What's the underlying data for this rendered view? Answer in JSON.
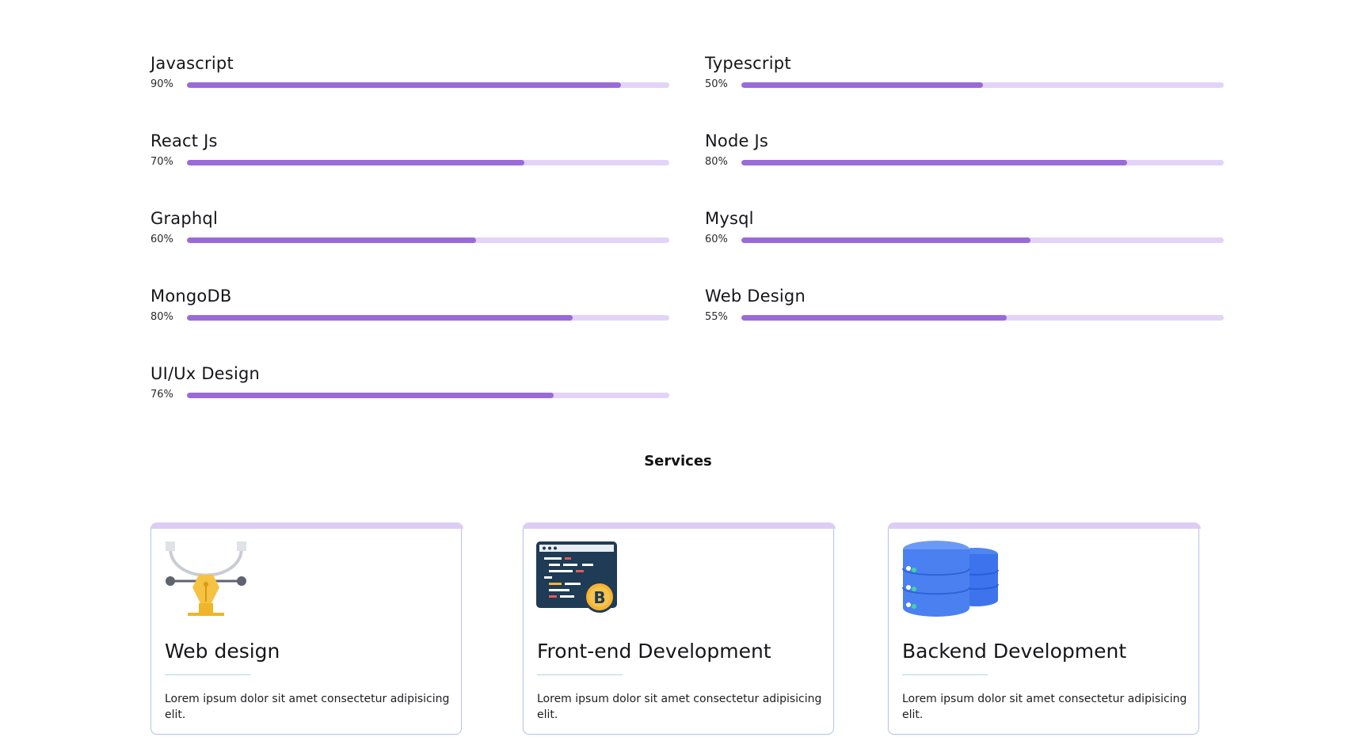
{
  "skills": [
    {
      "name": "Javascript",
      "percent_label": "90%",
      "value": 0.9
    },
    {
      "name": "Typescript",
      "percent_label": "50%",
      "value": 0.5
    },
    {
      "name": "React Js",
      "percent_label": "70%",
      "value": 0.7
    },
    {
      "name": "Node Js",
      "percent_label": "80%",
      "value": 0.8
    },
    {
      "name": "Graphql",
      "percent_label": "60%",
      "value": 0.6
    },
    {
      "name": "Mysql",
      "percent_label": "60%",
      "value": 0.6
    },
    {
      "name": "MongoDB",
      "percent_label": "80%",
      "value": 0.8
    },
    {
      "name": "Web Design",
      "percent_label": "55%",
      "value": 0.55
    },
    {
      "name": "UI/Ux Design",
      "percent_label": "76%",
      "value": 0.76
    }
  ],
  "services": {
    "title": "Services",
    "cards": [
      {
        "icon": "pen-tool-icon",
        "title": "Web design",
        "text": "Lorem ipsum dolor sit amet consectetur adipisicing elit."
      },
      {
        "icon": "code-window-bitcoin-icon",
        "title": "Front-end Development",
        "text": "Lorem ipsum dolor sit amet consectetur adipisicing elit."
      },
      {
        "icon": "database-icon",
        "title": "Backend Development",
        "text": "Lorem ipsum dolor sit amet consectetur adipisicing elit."
      }
    ]
  },
  "colors": {
    "bar_fill": "#9a6ad9",
    "bar_track": "#e3d3f8",
    "card_top": "#ddcdf6",
    "card_border": "#b9c5ea"
  }
}
